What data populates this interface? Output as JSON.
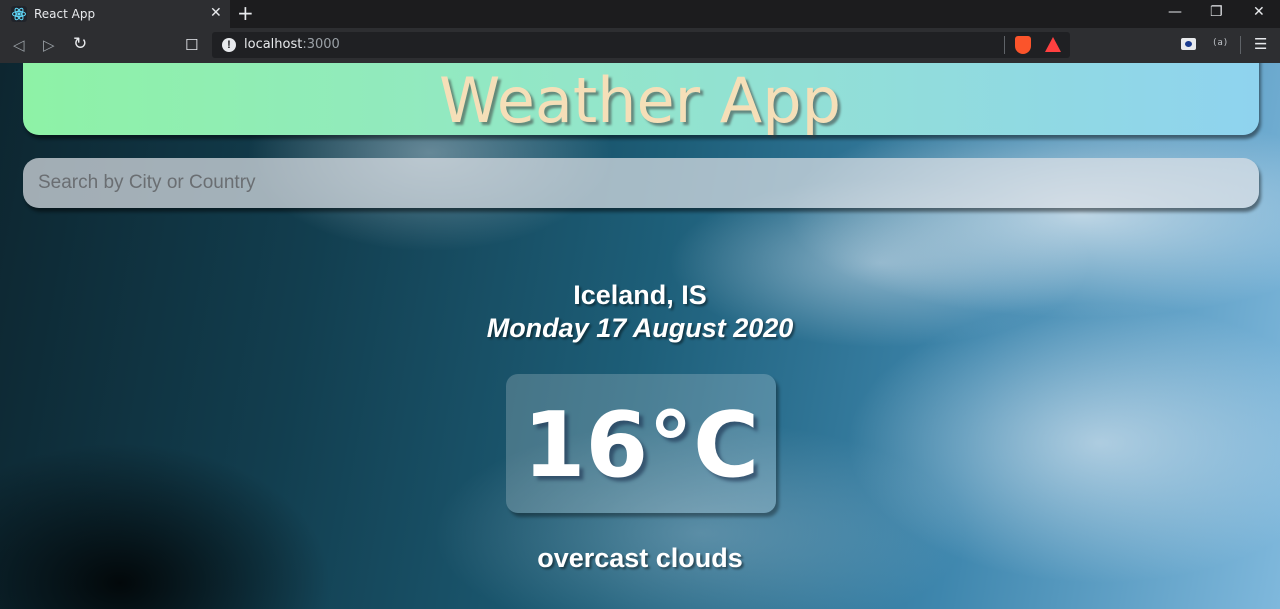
{
  "browser": {
    "tab_title": "React App",
    "tab_close_glyph": "✕",
    "new_tab_glyph": "+",
    "window_controls": {
      "minimize": "—",
      "restore": "❐",
      "close": "✕"
    },
    "nav": {
      "back": "◁",
      "forward": "▷",
      "reload": "↻",
      "bookmark": "☐"
    },
    "url_host": "localhost",
    "url_port": ":3000",
    "url_info_glyph": "!",
    "menu_glyph": "☰",
    "ext_label": "(a)",
    "icons": {
      "favicon": "react-logo-icon",
      "shields": "brave-shields-icon",
      "rewards": "brave-rewards-icon"
    }
  },
  "page": {
    "title": "Weather App",
    "search": {
      "placeholder": "Search by City or Country",
      "value": ""
    },
    "location": "Iceland, IS",
    "date": "Monday 17 August 2020",
    "temperature": "16°C",
    "description": "overcast clouds"
  },
  "colors": {
    "title_text": "#f5dfb8",
    "header_gradient_start": "#8ef2a6",
    "header_gradient_end": "#8fd3ef"
  }
}
